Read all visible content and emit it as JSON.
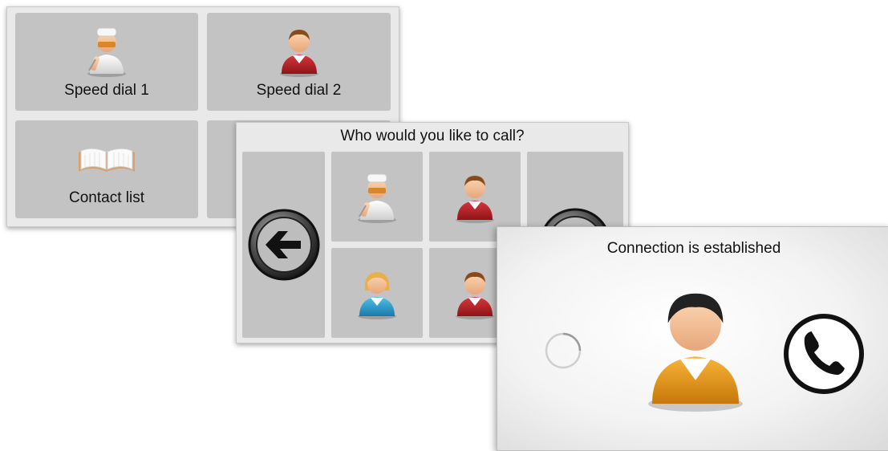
{
  "home": {
    "tiles": [
      {
        "label": "Speed dial 1",
        "icon": "nurse-icon"
      },
      {
        "label": "Speed dial 2",
        "icon": "person-red-icon"
      },
      {
        "label": "Contact list",
        "icon": "book-icon"
      },
      {
        "label": "",
        "icon": ""
      }
    ]
  },
  "who": {
    "title": "Who would you like to call?",
    "back_icon": "back-arrow-icon",
    "next_icon": "forward-arrow-icon",
    "contacts": [
      "nurse-icon",
      "person-red-icon",
      "person-blue-icon",
      "person-red-icon"
    ]
  },
  "connection": {
    "title": "Connection is established",
    "spinner_icon": "loading-spinner-icon",
    "avatar_icon": "person-orange-icon",
    "phone_icon": "phone-icon"
  },
  "colors": {
    "panel_bg": "#e9e9e9",
    "tile_bg": "#c3c3c3",
    "red_shirt": "#b8262c",
    "blue_shirt": "#2b9fd0",
    "orange_shirt": "#e79a1d",
    "nurse_white": "#f5f5f5"
  }
}
